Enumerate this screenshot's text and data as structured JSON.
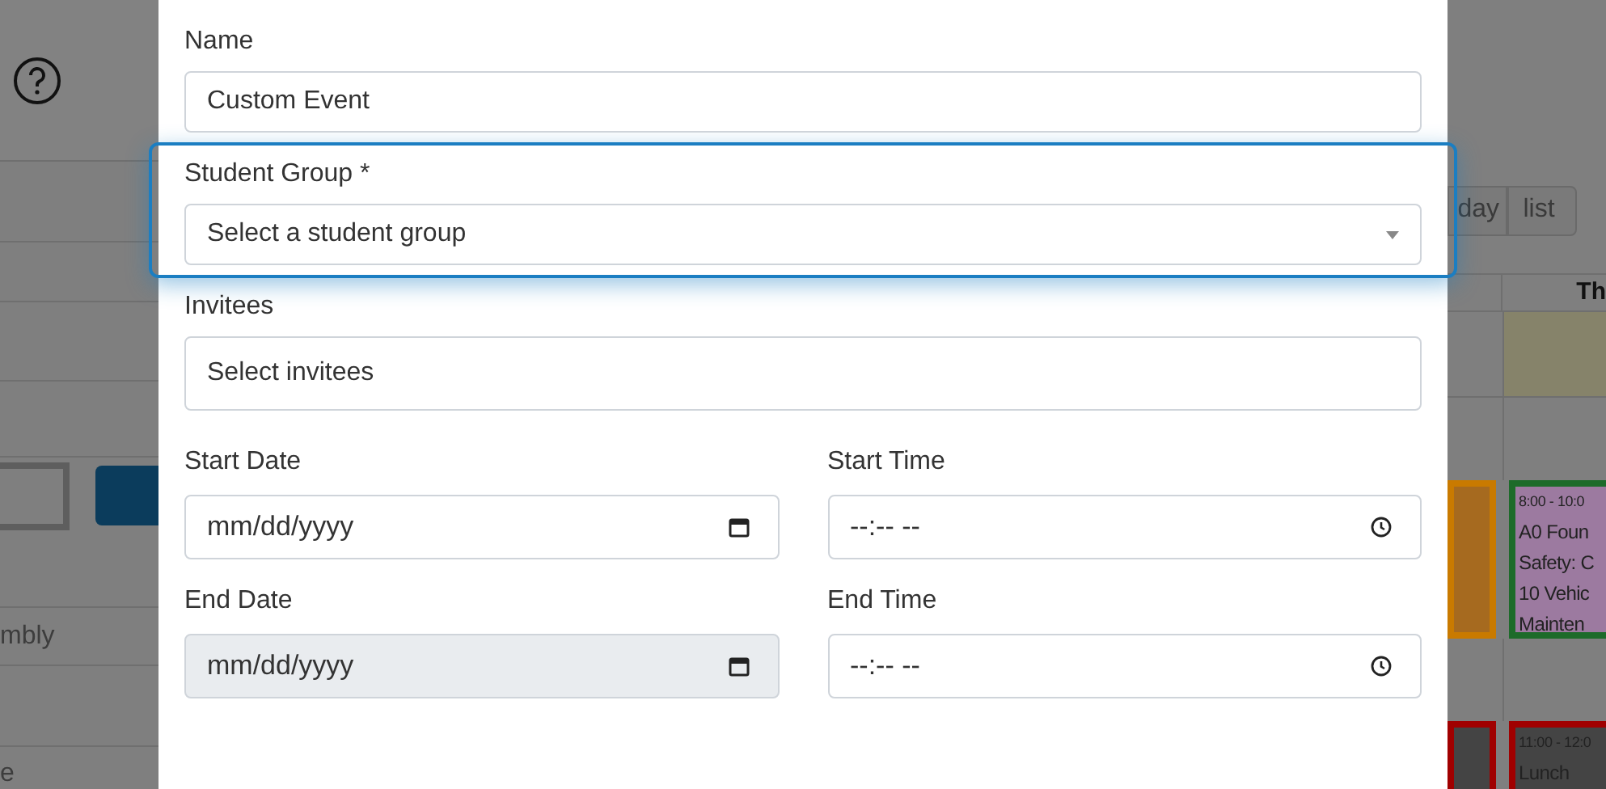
{
  "background": {
    "left_fragments": [
      {
        "text": "mbly"
      },
      {
        "text": "e"
      }
    ],
    "view_buttons": [
      {
        "label": "day",
        "selected": false
      },
      {
        "label": "list",
        "selected": false
      }
    ],
    "day_header": "Th",
    "events": [
      {
        "kind": "tinted",
        "color": "#c97a00"
      },
      {
        "kind": "lesson",
        "lines": [
          "8:00 - 10:0",
          "A0 Foun",
          "Safety: C",
          "10 Vehic",
          "Mainten"
        ],
        "color": "#1d6b2a"
      },
      {
        "kind": "break",
        "color": "#a00000"
      },
      {
        "kind": "break",
        "lines": [
          "11:00 - 12:0",
          "Lunch"
        ],
        "color": "#a00000"
      }
    ]
  },
  "modal": {
    "fields": [
      {
        "kind": "text",
        "label": "Name",
        "value": "Custom Event",
        "focused": false
      },
      {
        "kind": "select",
        "label": "Student Group *",
        "placeholder": "Select a student group",
        "focused": true
      },
      {
        "kind": "multi",
        "label": "Invitees",
        "placeholder": "Select invitees",
        "focused": false
      }
    ],
    "date_rows": [
      [
        {
          "kind": "date",
          "label": "Start Date",
          "placeholder": "mm/dd/yyyy",
          "disabled": false
        },
        {
          "kind": "time",
          "label": "Start Time",
          "placeholder": "--:-- --",
          "disabled": false
        }
      ],
      [
        {
          "kind": "date",
          "label": "End Date",
          "placeholder": "mm/dd/yyyy",
          "disabled": true
        },
        {
          "kind": "time",
          "label": "End Time",
          "placeholder": "--:-- --",
          "disabled": false
        }
      ]
    ]
  }
}
